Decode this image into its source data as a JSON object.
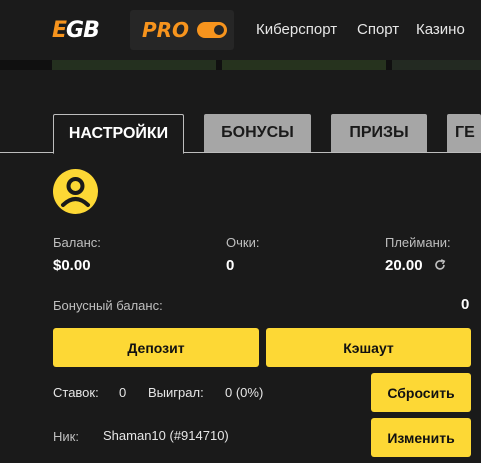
{
  "header": {
    "logo_e": "E",
    "logo_gb": "GB",
    "pro_label": "PRO",
    "nav": [
      "Киберспорт",
      "Спорт",
      "Казино"
    ]
  },
  "tabs": [
    "НАСТРОЙКИ",
    "БОНУСЫ",
    "ПРИЗЫ",
    "ГЕ"
  ],
  "account": {
    "balance_label": "Баланс:",
    "balance_value": "$0.00",
    "points_label": "Очки:",
    "points_value": "0",
    "playmoney_label": "Плеймани:",
    "playmoney_value": "20.00",
    "bonus_label": "Бонусный баланс:",
    "bonus_value": "0"
  },
  "buttons": {
    "deposit": "Депозит",
    "cashout": "Кэшаут",
    "reset": "Сбросить",
    "change": "Изменить"
  },
  "stats": {
    "bets_label": "Ставок:",
    "bets_value": "0",
    "won_label": "Выиграл:",
    "won_value": "0 (0%)"
  },
  "nick": {
    "label": "Ник:",
    "value": "Shaman10 (#914710)"
  },
  "colors": {
    "accent": "#fdd835",
    "brand_orange": "#f7941d",
    "background": "#1a1a1a",
    "inactive_tab": "#a6a6a6"
  },
  "icons": {
    "avatar": "user-avatar-icon",
    "refresh": "refresh-icon",
    "toggle": "pro-toggle-icon"
  }
}
